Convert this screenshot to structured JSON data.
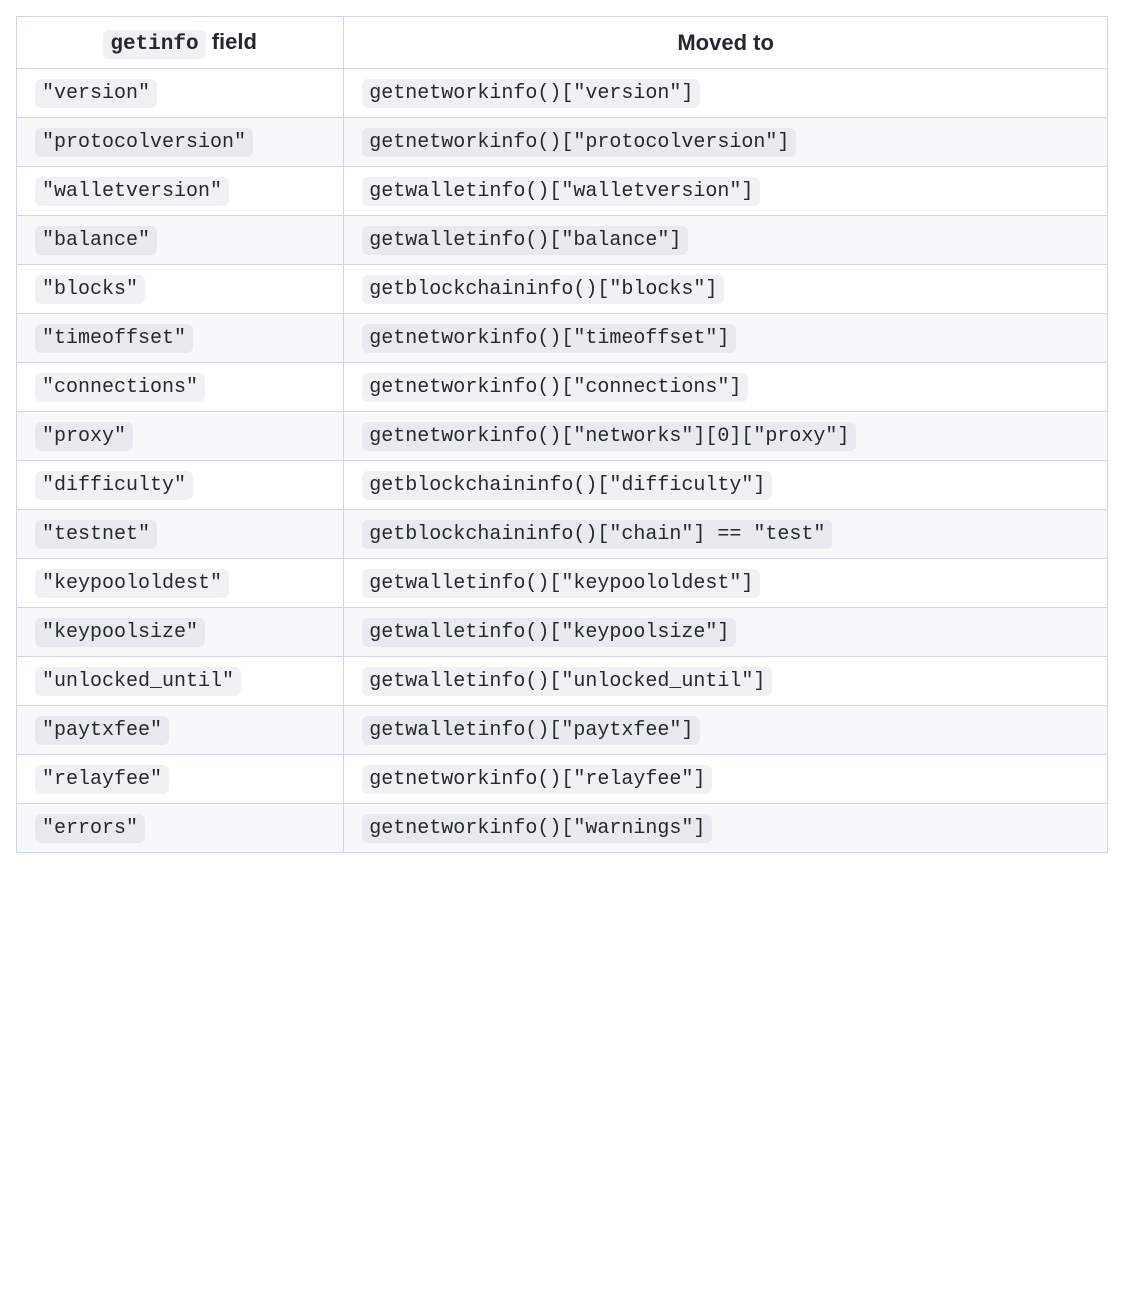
{
  "table": {
    "header": {
      "col1_code": "getinfo",
      "col1_text": " field",
      "col2": "Moved to"
    },
    "rows": [
      {
        "field": "\"version\"",
        "moved": "getnetworkinfo()[\"version\"]"
      },
      {
        "field": "\"protocolversion\"",
        "moved": "getnetworkinfo()[\"protocolversion\"]"
      },
      {
        "field": "\"walletversion\"",
        "moved": "getwalletinfo()[\"walletversion\"]"
      },
      {
        "field": "\"balance\"",
        "moved": "getwalletinfo()[\"balance\"]"
      },
      {
        "field": "\"blocks\"",
        "moved": "getblockchaininfo()[\"blocks\"]"
      },
      {
        "field": "\"timeoffset\"",
        "moved": "getnetworkinfo()[\"timeoffset\"]"
      },
      {
        "field": "\"connections\"",
        "moved": "getnetworkinfo()[\"connections\"]"
      },
      {
        "field": "\"proxy\"",
        "moved": "getnetworkinfo()[\"networks\"][0][\"proxy\"]"
      },
      {
        "field": "\"difficulty\"",
        "moved": "getblockchaininfo()[\"difficulty\"]"
      },
      {
        "field": "\"testnet\"",
        "moved": "getblockchaininfo()[\"chain\"] == \"test\""
      },
      {
        "field": "\"keypoololdest\"",
        "moved": "getwalletinfo()[\"keypoololdest\"]"
      },
      {
        "field": "\"keypoolsize\"",
        "moved": "getwalletinfo()[\"keypoolsize\"]"
      },
      {
        "field": "\"unlocked_until\"",
        "moved": "getwalletinfo()[\"unlocked_until\"]"
      },
      {
        "field": "\"paytxfee\"",
        "moved": "getwalletinfo()[\"paytxfee\"]"
      },
      {
        "field": "\"relayfee\"",
        "moved": "getnetworkinfo()[\"relayfee\"]"
      },
      {
        "field": "\"errors\"",
        "moved": "getnetworkinfo()[\"warnings\"]"
      }
    ]
  }
}
